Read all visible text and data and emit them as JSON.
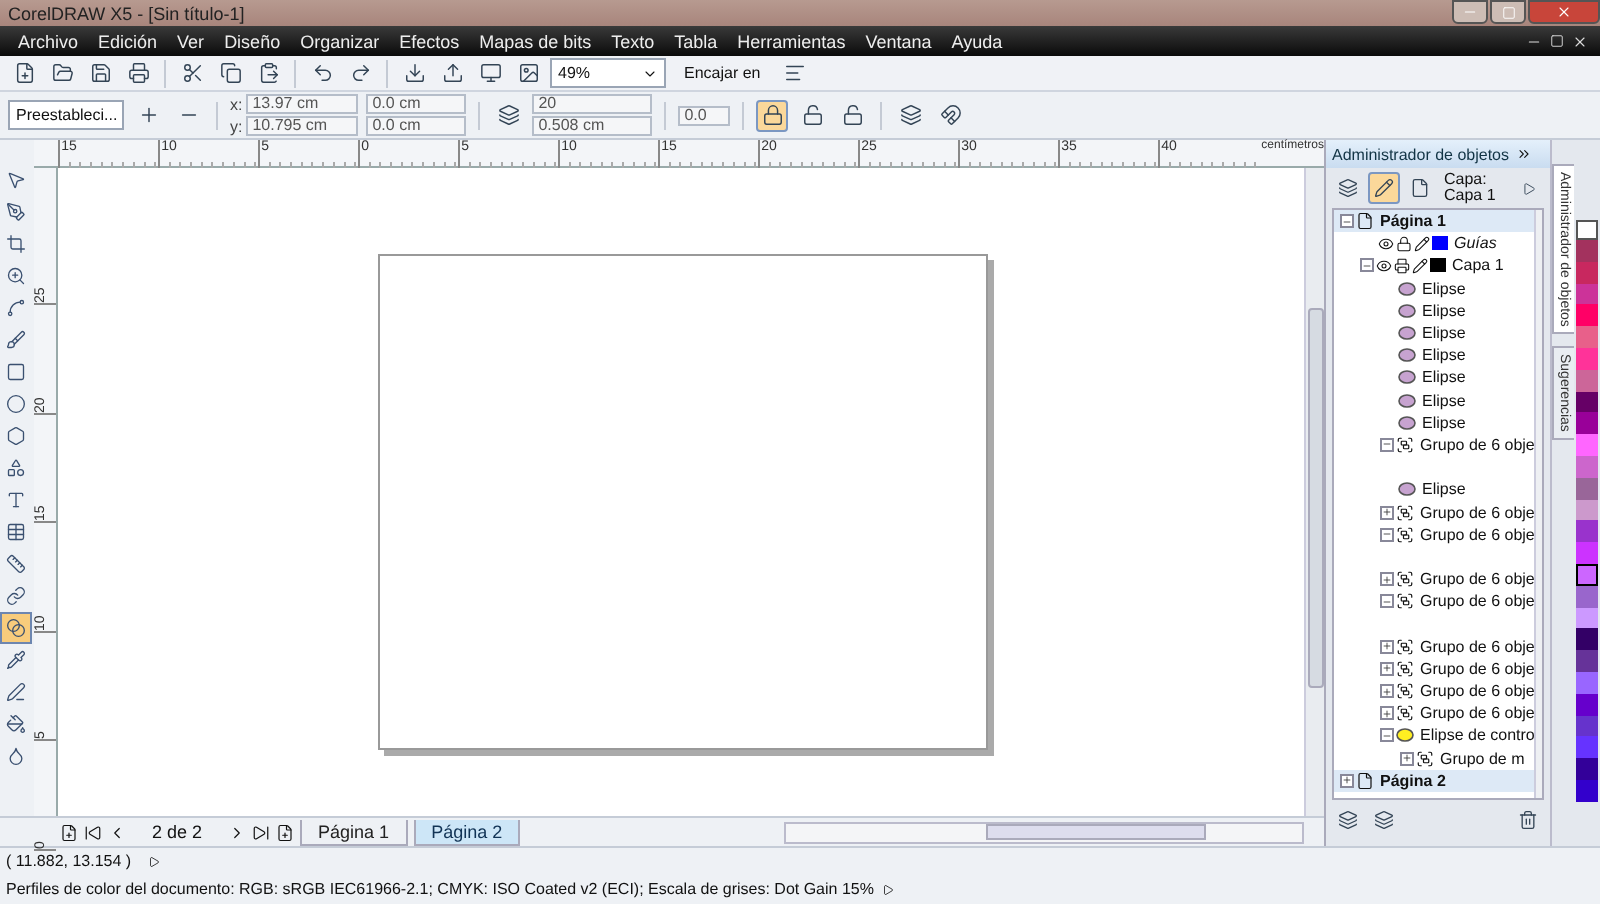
{
  "window": {
    "title": "CorelDRAW X5 - [Sin título-1]"
  },
  "menu": [
    "Archivo",
    "Edición",
    "Ver",
    "Diseño",
    "Organizar",
    "Efectos",
    "Mapas de bits",
    "Texto",
    "Tabla",
    "Herramientas",
    "Ventana",
    "Ayuda"
  ],
  "toolbar": {
    "zoom": "49%",
    "snap": "Encajar en"
  },
  "property_bar": {
    "preset": "Preestableci...",
    "x_label": "x:",
    "x": "13.97 cm",
    "y_label": "y:",
    "y": "10.795 cm",
    "offset_h": "0.0 cm",
    "offset_v": "0.0 cm",
    "steps": "20",
    "spacing": "0.508 cm",
    "angle": "0.0"
  },
  "tools": [
    {
      "selected": false
    },
    {
      "selected": false
    },
    {
      "selected": false
    },
    {
      "selected": false
    },
    {
      "selected": false
    },
    {
      "selected": false
    },
    {
      "selected": false
    },
    {
      "selected": false
    },
    {
      "selected": false
    },
    {
      "selected": false
    },
    {
      "selected": false
    },
    {
      "selected": false
    },
    {
      "selected": false
    },
    {
      "selected": false
    },
    {
      "selected": true
    },
    {
      "selected": false
    },
    {
      "selected": false
    },
    {
      "selected": false
    },
    {
      "selected": false
    }
  ],
  "ruler": {
    "top_labels": [
      "15",
      "10",
      "5",
      "0",
      "5",
      "10",
      "15",
      "20",
      "25",
      "30",
      "35",
      "40"
    ],
    "unit": "centímetros",
    "left_labels": [
      "25",
      "20",
      "15",
      "10",
      "5",
      "0"
    ]
  },
  "docker": {
    "title": "Administrador de objetos",
    "layer_label": "Capa:",
    "layer_name": "Capa 1",
    "tree": [
      {
        "kind": "page",
        "label": "Página 1",
        "expanded": true,
        "children": [
          {
            "kind": "guides",
            "label": "Guías",
            "color": "#0000ff"
          },
          {
            "kind": "layer",
            "label": "Capa 1",
            "color": "#000000",
            "expanded": true,
            "children": [
              {
                "kind": "ellipse",
                "label": "Elipse"
              },
              {
                "kind": "ellipse",
                "label": "Elipse"
              },
              {
                "kind": "ellipse",
                "label": "Elipse"
              },
              {
                "kind": "ellipse",
                "label": "Elipse"
              },
              {
                "kind": "ellipse",
                "label": "Elipse"
              },
              {
                "kind": "ellipse",
                "label": "Elipse"
              },
              {
                "kind": "ellipse",
                "label": "Elipse"
              },
              {
                "kind": "group",
                "label": "Grupo de 6 obje",
                "expanded": true
              },
              {
                "kind": "spacer"
              },
              {
                "kind": "ellipse",
                "label": "Elipse"
              },
              {
                "kind": "group",
                "label": "Grupo de 6 obje",
                "expanded": false
              },
              {
                "kind": "group",
                "label": "Grupo de 6 obje",
                "expanded": true
              },
              {
                "kind": "spacer"
              },
              {
                "kind": "group",
                "label": "Grupo de 6 obje",
                "expanded": false
              },
              {
                "kind": "group",
                "label": "Grupo de 6 obje",
                "expanded": true
              },
              {
                "kind": "spacer"
              },
              {
                "kind": "group",
                "label": "Grupo de 6 obje",
                "expanded": false
              },
              {
                "kind": "group",
                "label": "Grupo de 6 obje",
                "expanded": false
              },
              {
                "kind": "group",
                "label": "Grupo de 6 obje",
                "expanded": false
              },
              {
                "kind": "group",
                "label": "Grupo de 6 obje",
                "expanded": false
              },
              {
                "kind": "control",
                "label": "Elipse de contro",
                "expanded": true,
                "children": [
                  {
                    "kind": "group",
                    "label": "Grupo de m",
                    "expanded": false
                  }
                ]
              }
            ]
          }
        ]
      },
      {
        "kind": "page",
        "label": "Página 2",
        "expanded": false
      }
    ]
  },
  "side_tabs": [
    "Administrador de objetos",
    "Sugerencias"
  ],
  "palette": [
    {
      "color": "#a3325e",
      "selected": false
    },
    {
      "color": "#c8285f",
      "selected": false
    },
    {
      "color": "#cc3399",
      "selected": false
    },
    {
      "color": "#ff0066",
      "selected": false
    },
    {
      "color": "#e8608a",
      "selected": false
    },
    {
      "color": "#ff3399",
      "selected": false
    },
    {
      "color": "#cc6699",
      "selected": false
    },
    {
      "color": "#660066",
      "selected": false
    },
    {
      "color": "#990099",
      "selected": false
    },
    {
      "color": "#ff66ff",
      "selected": false
    },
    {
      "color": "#cc66cc",
      "selected": false
    },
    {
      "color": "#996699",
      "selected": false
    },
    {
      "color": "#cc99cc",
      "selected": false
    },
    {
      "color": "#9933cc",
      "selected": false
    },
    {
      "color": "#cc33ff",
      "selected": false
    },
    {
      "color": "#cc66ff",
      "selected": true
    },
    {
      "color": "#9966cc",
      "selected": false
    },
    {
      "color": "#cc99ff",
      "selected": false
    },
    {
      "color": "#330066",
      "selected": false
    },
    {
      "color": "#663399",
      "selected": false
    },
    {
      "color": "#9966ff",
      "selected": false
    },
    {
      "color": "#6600cc",
      "selected": false
    },
    {
      "color": "#6633cc",
      "selected": false
    },
    {
      "color": "#6633ff",
      "selected": false
    },
    {
      "color": "#330099",
      "selected": false
    },
    {
      "color": "#3300cc",
      "selected": false
    }
  ],
  "page_nav": {
    "counter": "2 de 2",
    "tabs": [
      {
        "label": "Página 1",
        "selected": false
      },
      {
        "label": "Página 2",
        "selected": true
      }
    ]
  },
  "status": {
    "coords": "( 11.882, 13.154 )",
    "profiles": "Perfiles de color del documento: RGB: sRGB IEC61966-2.1; CMYK: ISO Coated v2 (ECI); Escala de grises: Dot Gain 15%"
  }
}
